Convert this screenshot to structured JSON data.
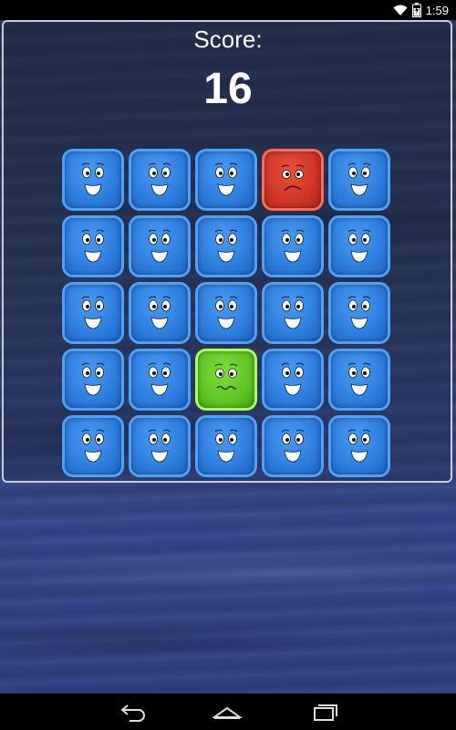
{
  "status_bar": {
    "time": "1:59",
    "icons": [
      "wifi-icon",
      "battery-charging-icon"
    ]
  },
  "game": {
    "score_label": "Score:",
    "score_value": "16",
    "grid": {
      "rows": 5,
      "cols": 5,
      "tiles": [
        [
          "blue-happy",
          "blue-happy",
          "blue-happy",
          "red-sad",
          "blue-happy"
        ],
        [
          "blue-happy",
          "blue-happy",
          "blue-happy",
          "blue-happy",
          "blue-happy"
        ],
        [
          "blue-happy",
          "blue-happy",
          "blue-happy",
          "blue-happy",
          "blue-happy"
        ],
        [
          "blue-happy",
          "blue-happy",
          "green-sick",
          "blue-happy",
          "blue-happy"
        ],
        [
          "blue-happy",
          "blue-happy",
          "blue-happy",
          "blue-happy",
          "blue-happy"
        ]
      ]
    }
  },
  "nav_bar": {
    "buttons": [
      "back-icon",
      "home-icon",
      "recent-apps-icon"
    ]
  },
  "colors": {
    "blue_tile": "#2f7fe0",
    "red_tile": "#cf3524",
    "green_tile": "#5fc426",
    "panel_border": "#c8ccd8"
  }
}
